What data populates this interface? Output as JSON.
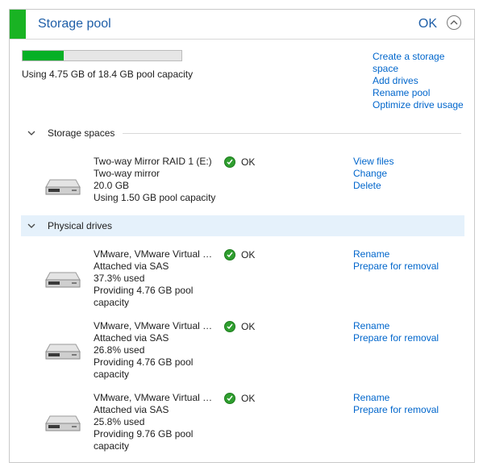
{
  "header": {
    "title": "Storage pool",
    "status": "OK"
  },
  "pool": {
    "usage_fraction": 0.258,
    "capacity_text": "Using 4.75 GB of 18.4 GB pool capacity",
    "links": [
      "Create a storage space",
      "Add drives",
      "Rename pool",
      "Optimize drive usage"
    ]
  },
  "storage_spaces": {
    "title": "Storage spaces",
    "items": [
      {
        "name": "Two-way Mirror RAID 1 (E:)",
        "type": "Two-way mirror",
        "size": "20.0 GB",
        "usage": "Using 1.50 GB pool capacity",
        "status": "OK",
        "actions": [
          "View files",
          "Change",
          "Delete"
        ]
      }
    ]
  },
  "physical_drives": {
    "title": "Physical drives",
    "items": [
      {
        "name": "VMware, VMware Virtual S...",
        "connection": "Attached via SAS",
        "used": "37.3% used",
        "providing": "Providing 4.76 GB pool capacity",
        "status": "OK",
        "actions": [
          "Rename",
          "Prepare for removal"
        ]
      },
      {
        "name": "VMware, VMware Virtual S...",
        "connection": "Attached via SAS",
        "used": "26.8% used",
        "providing": "Providing 4.76 GB pool capacity",
        "status": "OK",
        "actions": [
          "Rename",
          "Prepare for removal"
        ]
      },
      {
        "name": "VMware, VMware Virtual S...",
        "connection": "Attached via SAS",
        "used": "25.8% used",
        "providing": "Providing 9.76 GB pool capacity",
        "status": "OK",
        "actions": [
          "Rename",
          "Prepare for removal"
        ]
      }
    ]
  },
  "colors": {
    "accent": "#19b323",
    "progress": "#06b025",
    "link": "#0066cc",
    "title": "#1f5fa8",
    "highlight": "#e5f1fb"
  },
  "icons": {
    "collapse": "chevron-up-icon",
    "section": "chevron-down-icon",
    "drive": "hard-drive-icon",
    "status": "check-circle-icon"
  }
}
